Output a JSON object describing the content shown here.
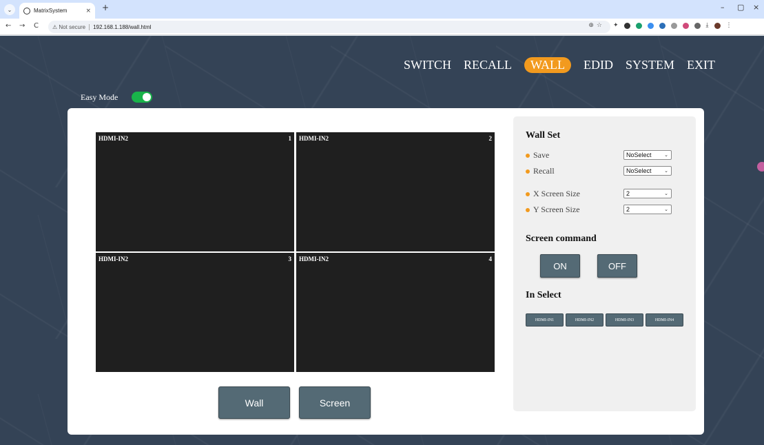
{
  "browser": {
    "tab_title": "MatrixSystem",
    "close_glyph": "×",
    "new_tab_glyph": "+",
    "url_security": "⚠ Not secure",
    "url": "192.168.1.188/wall.html",
    "nav_back": "←",
    "nav_forward": "→",
    "nav_reload": "C",
    "omni_icons": "⊕☆",
    "window_controls": {
      "minimize": "–",
      "maximize": "▢",
      "close": "×"
    }
  },
  "nav": {
    "items": [
      {
        "label": "SWITCH",
        "active": false
      },
      {
        "label": "RECALL",
        "active": false
      },
      {
        "label": "WALL",
        "active": true
      },
      {
        "label": "EDID",
        "active": false
      },
      {
        "label": "SYSTEM",
        "active": false
      },
      {
        "label": "EXIT",
        "active": false
      }
    ]
  },
  "easy_mode": {
    "label": "Easy Mode",
    "on": true
  },
  "wall_grid": {
    "cells": [
      {
        "source": "HDMI-IN2",
        "number": "1"
      },
      {
        "source": "HDMI-IN2",
        "number": "2"
      },
      {
        "source": "HDMI-IN2",
        "number": "3"
      },
      {
        "source": "HDMI-IN2",
        "number": "4"
      }
    ]
  },
  "actions": {
    "wall_label": "Wall",
    "screen_label": "Screen"
  },
  "wall_set": {
    "title": "Wall Set",
    "save": {
      "label": "Save",
      "value": "NoSelect"
    },
    "recall": {
      "label": "Recall",
      "value": "NoSelect"
    },
    "x_size": {
      "label": "X Screen Size",
      "value": "2"
    },
    "y_size": {
      "label": "Y Screen Size",
      "value": "2"
    }
  },
  "screen_command": {
    "title": "Screen command",
    "on_label": "ON",
    "off_label": "OFF"
  },
  "in_select": {
    "title": "In Select",
    "inputs": [
      "HDMI-IN1",
      "HDMI-IN2",
      "HDMI-IN3",
      "HDMI-IN4"
    ]
  },
  "colors": {
    "accent": "#f29a1e",
    "toggle_on": "#19b34a",
    "button": "#546a75",
    "background": "#344356",
    "cell": "#1f1f1f"
  }
}
